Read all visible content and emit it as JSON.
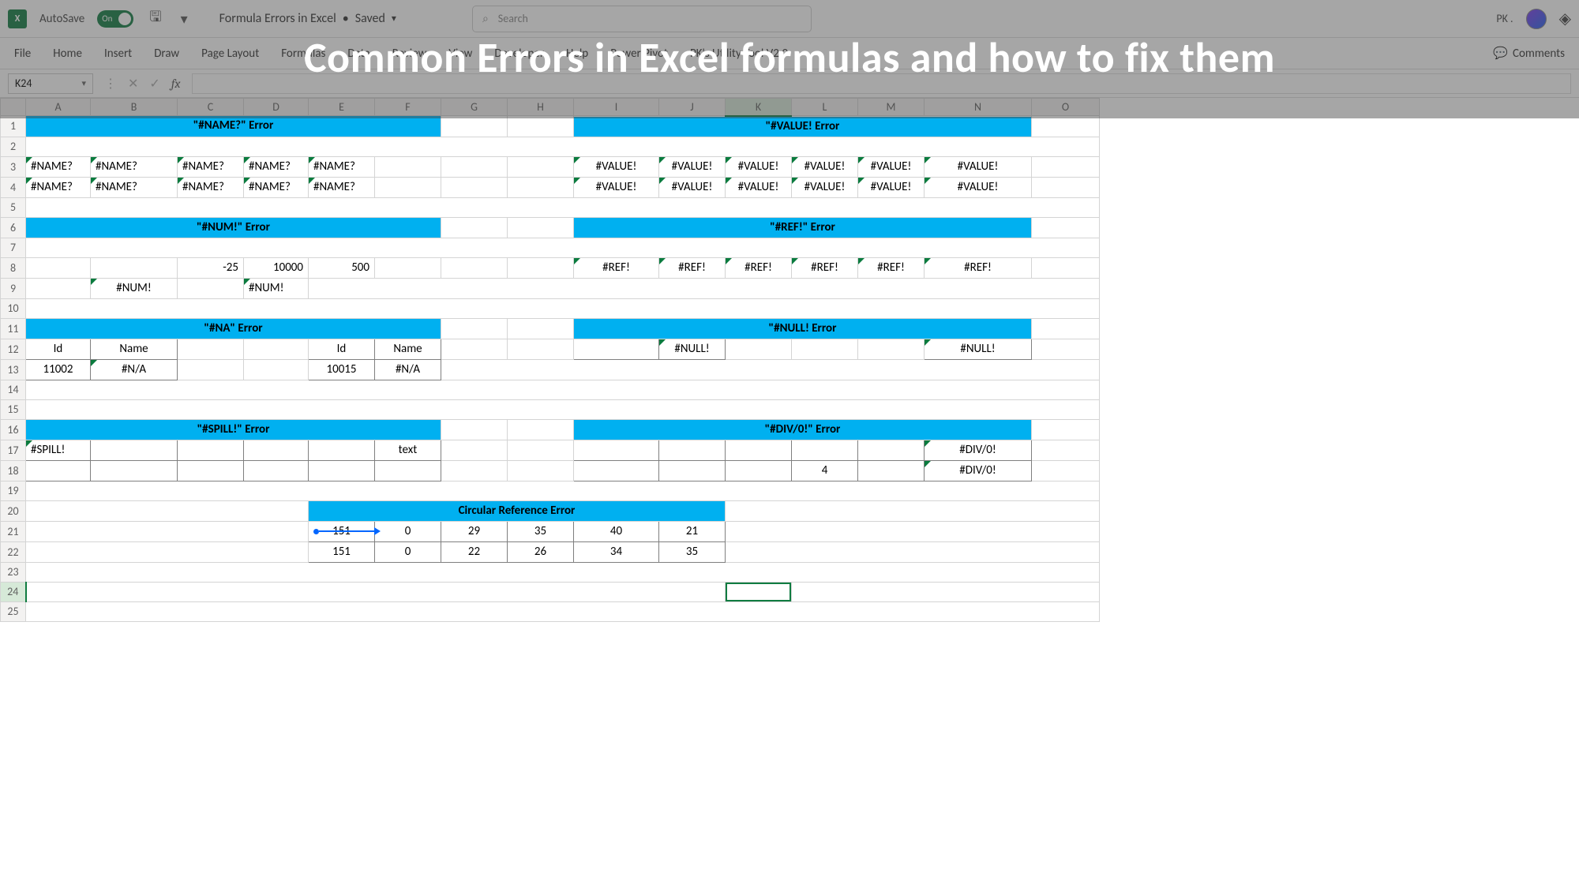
{
  "title_bar": {
    "autosave_label": "AutoSave",
    "autosave_on": "On",
    "doc_name": "Formula Errors in Excel",
    "doc_status": "Saved",
    "search_placeholder": "Search",
    "user_label": "PK .",
    "logo_letter": "X"
  },
  "overlay_title": "Common Errors in Excel formulas and how to fix them",
  "ribbon": {
    "tabs": [
      "File",
      "Home",
      "Insert",
      "Draw",
      "Page Layout",
      "Formulas",
      "Data",
      "Review",
      "View",
      "Developer",
      "Help",
      "Power Pivot",
      "PK's Utility Tool V2.0"
    ],
    "comments": "Comments"
  },
  "name_box": "K24",
  "columns": [
    "A",
    "B",
    "C",
    "D",
    "E",
    "F",
    "G",
    "H",
    "I",
    "J",
    "K",
    "L",
    "M",
    "N",
    "O"
  ],
  "rows": [
    "1",
    "2",
    "3",
    "4",
    "5",
    "6",
    "7",
    "8",
    "9",
    "10",
    "11",
    "12",
    "13",
    "14",
    "15",
    "16",
    "17",
    "18",
    "19",
    "20",
    "21",
    "22",
    "23",
    "24",
    "25"
  ],
  "headers": {
    "name_error": "\"#NAME?\" Error",
    "value_error": "\"#VALUE! Error",
    "num_error": "\"#NUM!\" Error",
    "ref_error": "\"#REF!\" Error",
    "na_error": "\"#NA\" Error",
    "null_error": "\"#NULL! Error",
    "spill_error": "\"#SPILL!\" Error",
    "div0_error": "\"#DIV/0!\" Error",
    "circular_error": "Circular Reference Error"
  },
  "name_vals": {
    "r3": [
      "#NAME?",
      "#NAME?",
      "#NAME?",
      "#NAME?",
      "#NAME?"
    ],
    "r4": [
      "#NAME?",
      "#NAME?",
      "#NAME?",
      "#NAME?",
      "#NAME?"
    ]
  },
  "value_vals": {
    "r3": [
      "#VALUE!",
      "#VALUE!",
      "#VALUE!",
      "#VALUE!",
      "#VALUE!",
      "#VALUE!"
    ],
    "r4": [
      "#VALUE!",
      "#VALUE!",
      "#VALUE!",
      "#VALUE!",
      "#VALUE!",
      "#VALUE!"
    ]
  },
  "num_vals": {
    "c8": "-25",
    "d8": "10000",
    "e8": "500",
    "b9": "#NUM!",
    "d9": "#NUM!"
  },
  "ref_vals": {
    "r8": [
      "#REF!",
      "#REF!",
      "#REF!",
      "#REF!",
      "#REF!",
      "#REF!"
    ]
  },
  "na_block": {
    "id_hdr": "Id",
    "name_hdr": "Name",
    "a13": "11002",
    "b13": "#N/A",
    "e12": "Id",
    "f12": "Name",
    "e13": "10015",
    "f13": "#N/A"
  },
  "null_vals": {
    "j12": "#NULL!",
    "n12": "#NULL!"
  },
  "spill_vals": {
    "a17": "#SPILL!",
    "f17": "text"
  },
  "div0_vals": {
    "n17": "#DIV/0!",
    "l18": "4",
    "n18": "#DIV/0!"
  },
  "circular": {
    "r21": [
      "151",
      "0",
      "29",
      "35",
      "40",
      "21"
    ],
    "r22": [
      "151",
      "0",
      "22",
      "26",
      "34",
      "35"
    ]
  }
}
